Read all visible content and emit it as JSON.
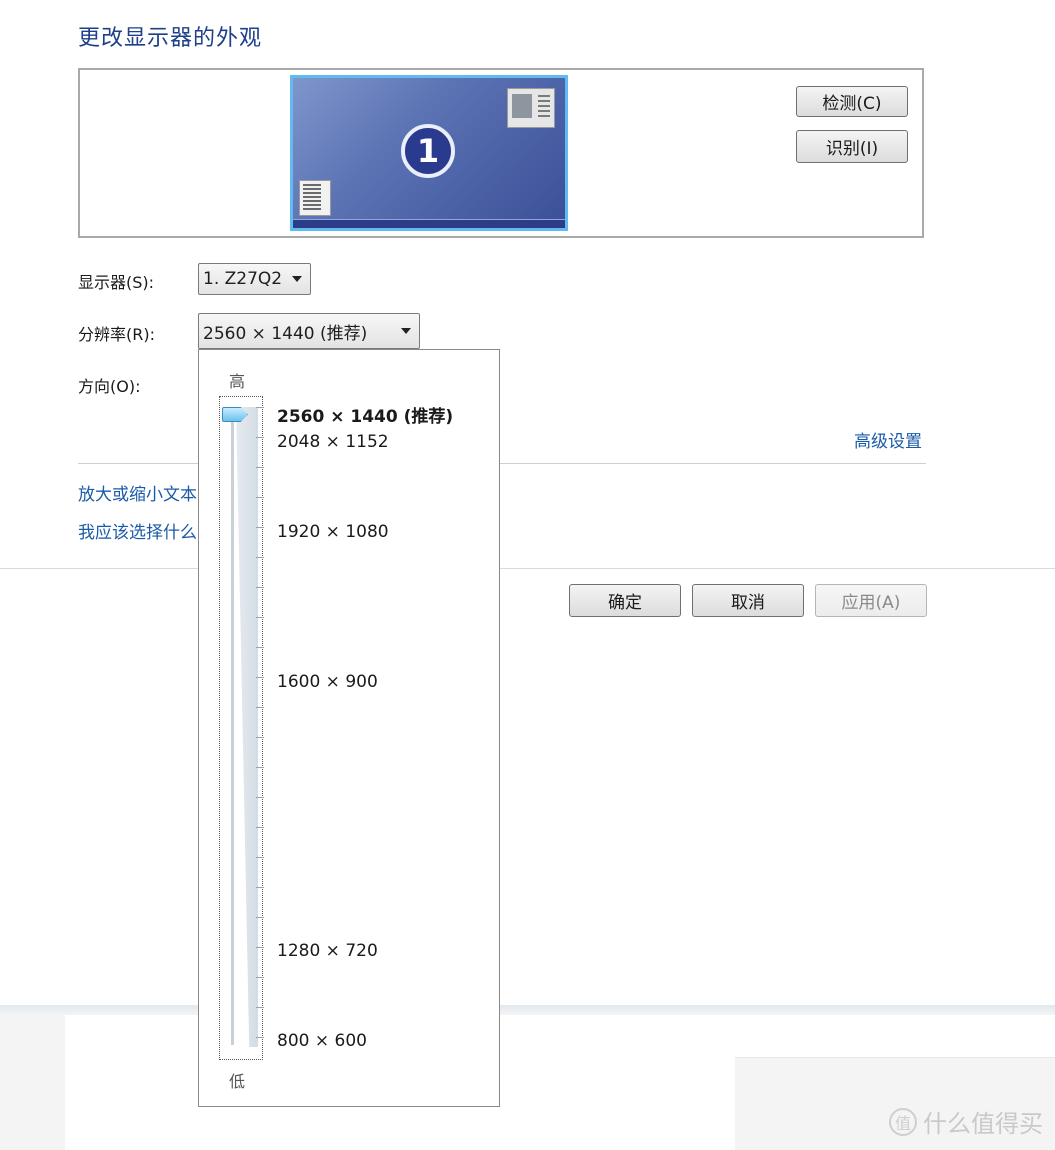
{
  "page": {
    "title": "更改显示器的外观"
  },
  "preview": {
    "monitor_number": "1"
  },
  "buttons": {
    "detect": "检测(C)",
    "identify": "识别(I)",
    "ok": "确定",
    "cancel": "取消",
    "apply": "应用(A)"
  },
  "fields": {
    "display_label": "显示器(S):",
    "display_value": "1. Z27Q2",
    "resolution_label": "分辨率(R):",
    "resolution_value": "2560 × 1440 (推荐)",
    "orientation_label": "方向(O):"
  },
  "links": {
    "advanced": "高级设置",
    "text_size": "放大或缩小文本",
    "which_settings": "我应该选择什么"
  },
  "dropdown": {
    "high_label": "高",
    "low_label": "低",
    "selected_value": "2560 × 1440 (推荐)",
    "options": [
      "2560 × 1440 (推荐)",
      "2048 × 1152",
      "1920 × 1080",
      "1600 × 900",
      "1280 × 720",
      "800 × 600"
    ]
  },
  "watermark": {
    "text": "什么值得买",
    "icon_glyph": "值"
  }
}
